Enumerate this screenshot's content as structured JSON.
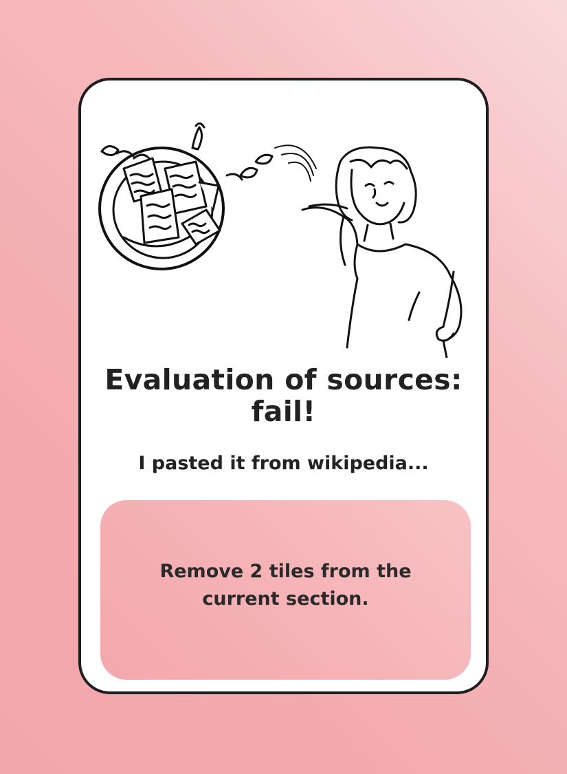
{
  "card": {
    "title_line1": "Evaluation of sources:",
    "title_line2": "fail!",
    "subtitle": "I pasted it from wikipedia...",
    "action_line1": "Remove 2 tiles from the",
    "action_line2": "current section."
  },
  "illustration": {
    "icon": "woman-presenting-papers-on-plate",
    "stroke_color": "#111111"
  },
  "colors": {
    "background": "#f3a9ad",
    "card": "#ffffff",
    "card_border": "#1e1e1e",
    "action_box": "#f6b4b8",
    "text": "#222222"
  }
}
